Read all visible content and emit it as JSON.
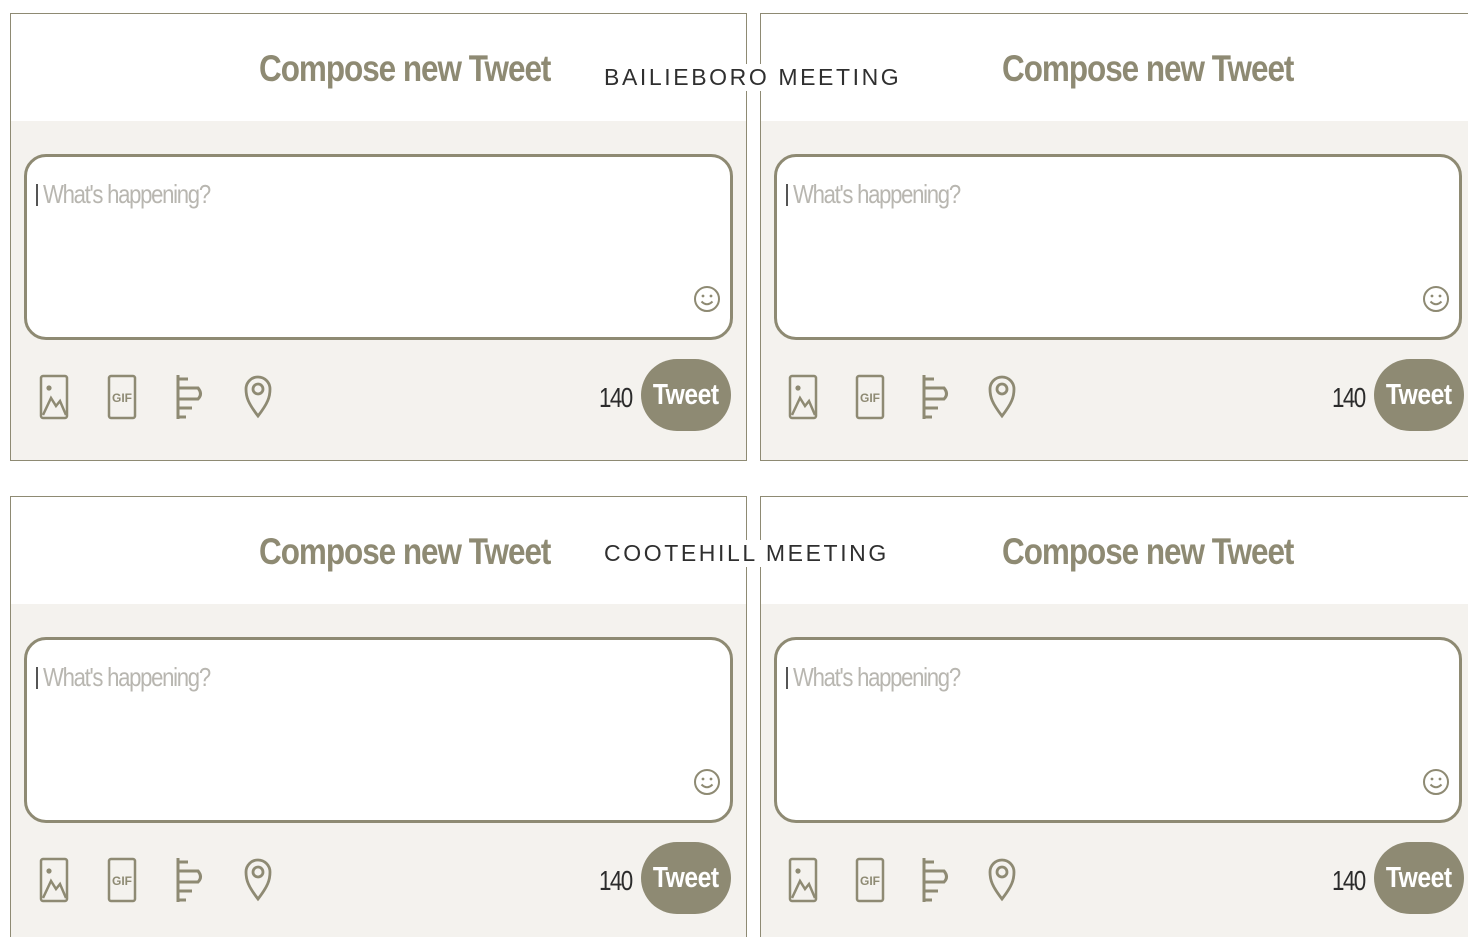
{
  "colors": {
    "accent": "#8e8a73",
    "panel_background": "#f4f2ee"
  },
  "meetings": [
    {
      "name": "BAILIEBORO MEETING"
    },
    {
      "name": "COOTEHILL MEETING"
    }
  ],
  "panels": [
    {
      "title": "Compose new Tweet",
      "placeholder": "What's happening?",
      "char_count": "140",
      "tweet_label": "Tweet"
    },
    {
      "title": "Compose new Tweet",
      "placeholder": "What's happening?",
      "char_count": "140",
      "tweet_label": "Tweet"
    },
    {
      "title": "Compose new Tweet",
      "placeholder": "What's happening?",
      "char_count": "140",
      "tweet_label": "Tweet"
    },
    {
      "title": "Compose new Tweet",
      "placeholder": "What's happening?",
      "char_count": "140",
      "tweet_label": "Tweet"
    }
  ],
  "icons": [
    "image-icon",
    "gif-icon",
    "poll-icon",
    "location-icon",
    "emoji-icon"
  ]
}
